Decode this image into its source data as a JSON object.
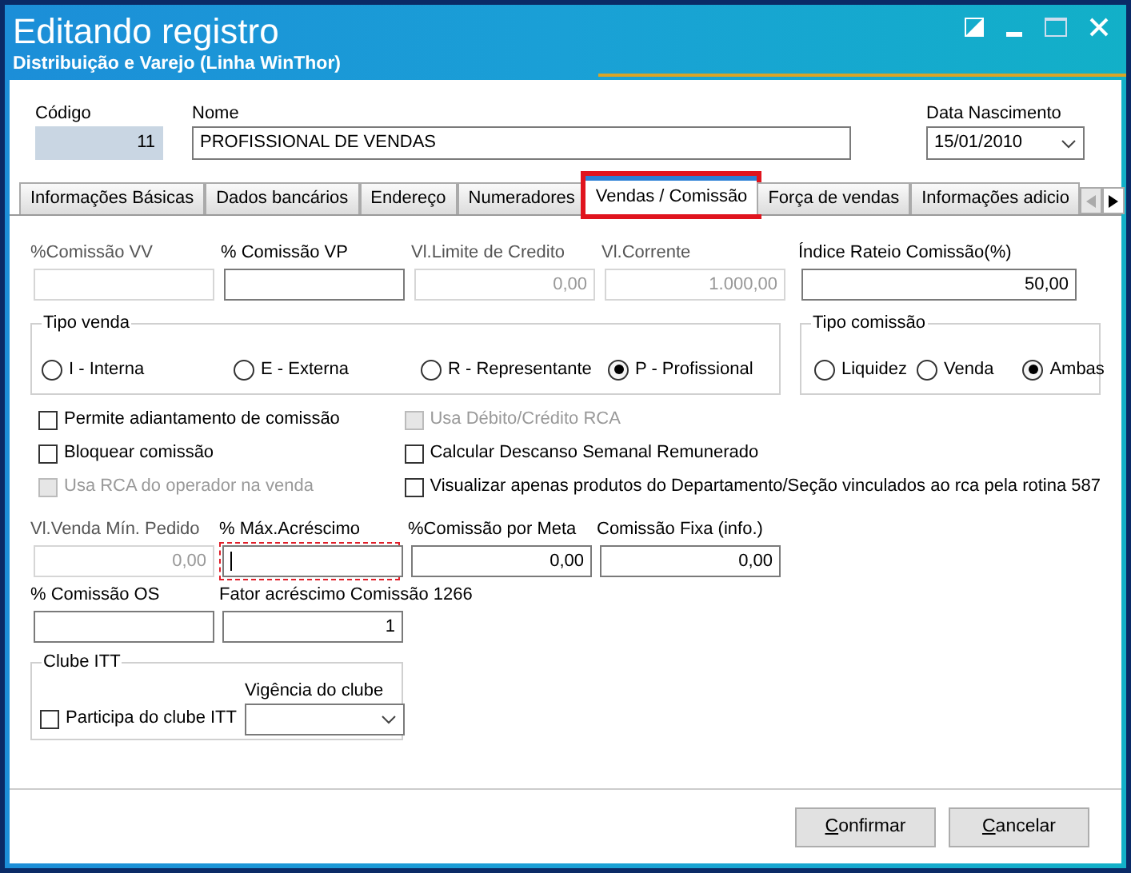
{
  "window": {
    "title": "Editando registro",
    "subtitle": "Distribuição e Varejo (Linha WinThor)"
  },
  "header_fields": [
    {
      "label": "Código",
      "value": "11",
      "kind": "readonly"
    },
    {
      "label": "Nome",
      "value": "PROFISSIONAL DE VENDAS",
      "kind": "text"
    },
    {
      "label": "Data Nascimento",
      "value": "15/01/2010",
      "kind": "date"
    }
  ],
  "tabs": [
    {
      "label": "Informações Básicas",
      "selected": false,
      "highlighted": false
    },
    {
      "label": "Dados bancários",
      "selected": false,
      "highlighted": false
    },
    {
      "label": "Endereço",
      "selected": false,
      "highlighted": false
    },
    {
      "label": "Numeradores",
      "selected": false,
      "highlighted": false
    },
    {
      "label": "Vendas  / Comissão",
      "selected": true,
      "highlighted": true
    },
    {
      "label": "Força de vendas",
      "selected": false,
      "highlighted": false
    },
    {
      "label": "Informações adicio",
      "selected": false,
      "highlighted": false
    }
  ],
  "fields_row1": [
    {
      "label": "%Comissão VV",
      "disabled": true
    },
    {
      "label": "% Comissão VP",
      "disabled": false
    },
    {
      "label": "Vl.Limite de Credito",
      "value": "0,00",
      "disabled": true
    },
    {
      "label": "Vl.Corrente",
      "value": "1.000,00",
      "disabled": true
    }
  ],
  "indice": {
    "label": "Índice Rateio Comissão(%)",
    "value": "50,00"
  },
  "tipo_venda": {
    "title": "Tipo venda",
    "options": [
      {
        "label": "I - Interna",
        "selected": false
      },
      {
        "label": "E - Externa",
        "selected": false
      },
      {
        "label": "R - Representante",
        "selected": false
      },
      {
        "label": "P - Profissional",
        "selected": true
      }
    ]
  },
  "tipo_comissao": {
    "title": "Tipo comissão",
    "options": [
      {
        "label": "Liquidez",
        "selected": false
      },
      {
        "label": "Venda",
        "selected": false
      },
      {
        "label": "Ambas",
        "selected": true
      }
    ]
  },
  "checkboxes_left": [
    {
      "label": "Permite adiantamento de comissão",
      "checked": false,
      "disabled": false
    },
    {
      "label": "Bloquear comissão",
      "checked": false,
      "disabled": false
    },
    {
      "label": "Usa RCA do operador na venda",
      "checked": false,
      "disabled": true
    }
  ],
  "checkboxes_right": [
    {
      "label": "Usa Débito/Crédito RCA",
      "checked": false,
      "disabled": true
    },
    {
      "label": "Calcular Descanso Semanal Remunerado",
      "checked": false,
      "disabled": false
    },
    {
      "label": "Visualizar apenas produtos do Departamento/Seção vinculados ao rca pela rotina 587",
      "checked": false,
      "disabled": false
    }
  ],
  "fields_row2": [
    {
      "label": "Vl.Venda Mín. Pedido",
      "value": "0,00",
      "disabled": true,
      "highlighted": false
    },
    {
      "label": "% Máx.Acréscimo",
      "disabled": false,
      "highlighted": true
    },
    {
      "label": "%Comissão por Meta",
      "value": "0,00",
      "disabled": false,
      "highlighted": false
    },
    {
      "label": "Comissão Fixa (info.)",
      "value": "0,00",
      "disabled": false,
      "highlighted": false
    }
  ],
  "fields_row3": [
    {
      "label": "% Comissão OS"
    },
    {
      "label": "Fator acréscimo Comissão 1266",
      "value": "1"
    }
  ],
  "clube": {
    "title": "Clube ITT",
    "checkbox": {
      "label": "Participa do clube ITT",
      "checked": false
    },
    "dropdown_label": "Vigência do clube"
  },
  "buttons": [
    "Confirmar",
    "Cancelar"
  ]
}
